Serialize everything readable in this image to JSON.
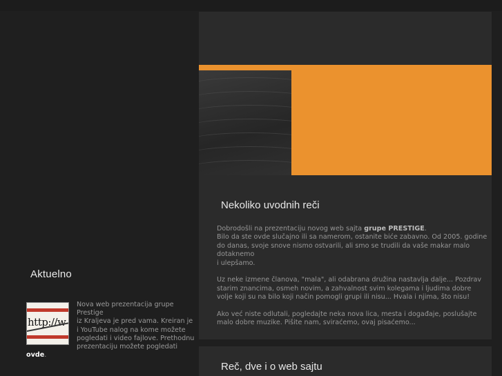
{
  "sidebar": {
    "aktuelno_title": "Aktuelno",
    "news": {
      "thumb_text": "http://w",
      "line1": "Nova web prezentacija grupe Prestige",
      "line2": "iz Kraljeva je pred vama. Kreiran je i YouTube nalog na kome možete pogledati i video fajlove. Prethodnu prezentaciju možete pogledati",
      "link_text": "ovde",
      "end": "."
    }
  },
  "main": {
    "heading": "Nekoliko uvodnih reči",
    "p1_a": "Dobrodošli na prezentaciju novog web sajta",
    "p1_brand": "grupe PRESTIGE",
    "p1_b": ".",
    "p1_c": "Bilo da ste ovde slučajno ili sa namerom, ostanite biće zabavno. Od 2005. godine do danas, svoje snove nismo ostvarili, ali smo se trudili da vaše makar malo dotaknemo",
    "p1_d": "i ulepšamo.",
    "p2": "Uz neke izmene članova, \"mala\", ali odabrana družina nastavlja dalje... Pozdrav starim znancima, osmeh novim, a zahvalnost svim kolegama i ljudima dobre volje koji su na bilo koji način pomogli grupi ili nisu... Hvala i njima, što nisu!",
    "p3": "Ako već niste odlutali, pogledajte neka nova lica, mesta i događaje, poslušajte malo dobre muzike. Pišite nam, sviraćemo, ovaj pisaćemo...",
    "second_heading": "Reč, dve i o web sajtu"
  },
  "colors": {
    "background": "#1f1f1f",
    "panel": "#2b2b2b",
    "accent_orange": "#eb922e"
  }
}
